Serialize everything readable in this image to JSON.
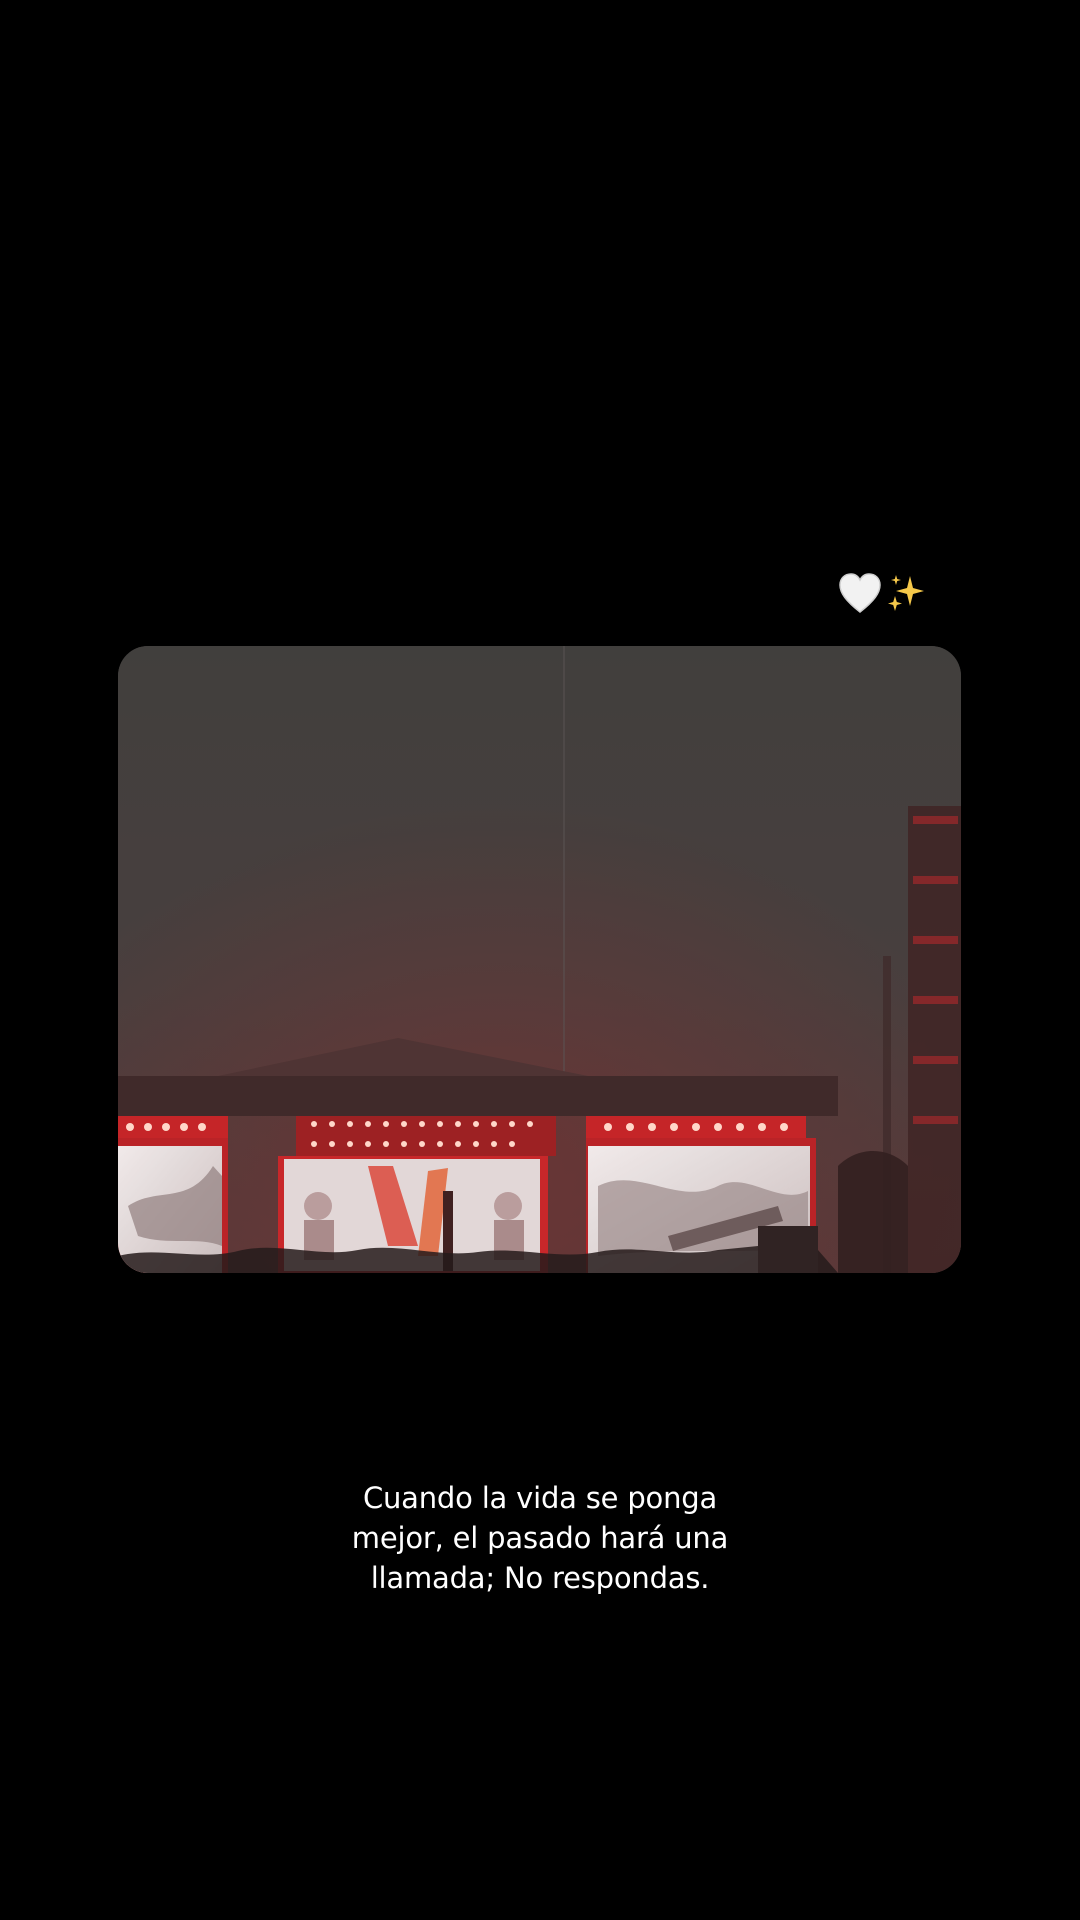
{
  "emojis": [
    {
      "name": "white-heart-icon",
      "color": "#f2f2f2"
    },
    {
      "name": "sparkles-icon",
      "color": "#f5c84a"
    }
  ],
  "media": {
    "description_icon": "concert-stage-video",
    "palette": {
      "sky_top": "#3b3937",
      "sky_bottom": "#4a3434",
      "stage_red": "#e0262a",
      "screen_white": "#e9e3e3"
    }
  },
  "caption": {
    "lines": [
      "Cuando la vida se ponga",
      "mejor, el pasado hará una",
      "llamada; No respondas."
    ]
  }
}
